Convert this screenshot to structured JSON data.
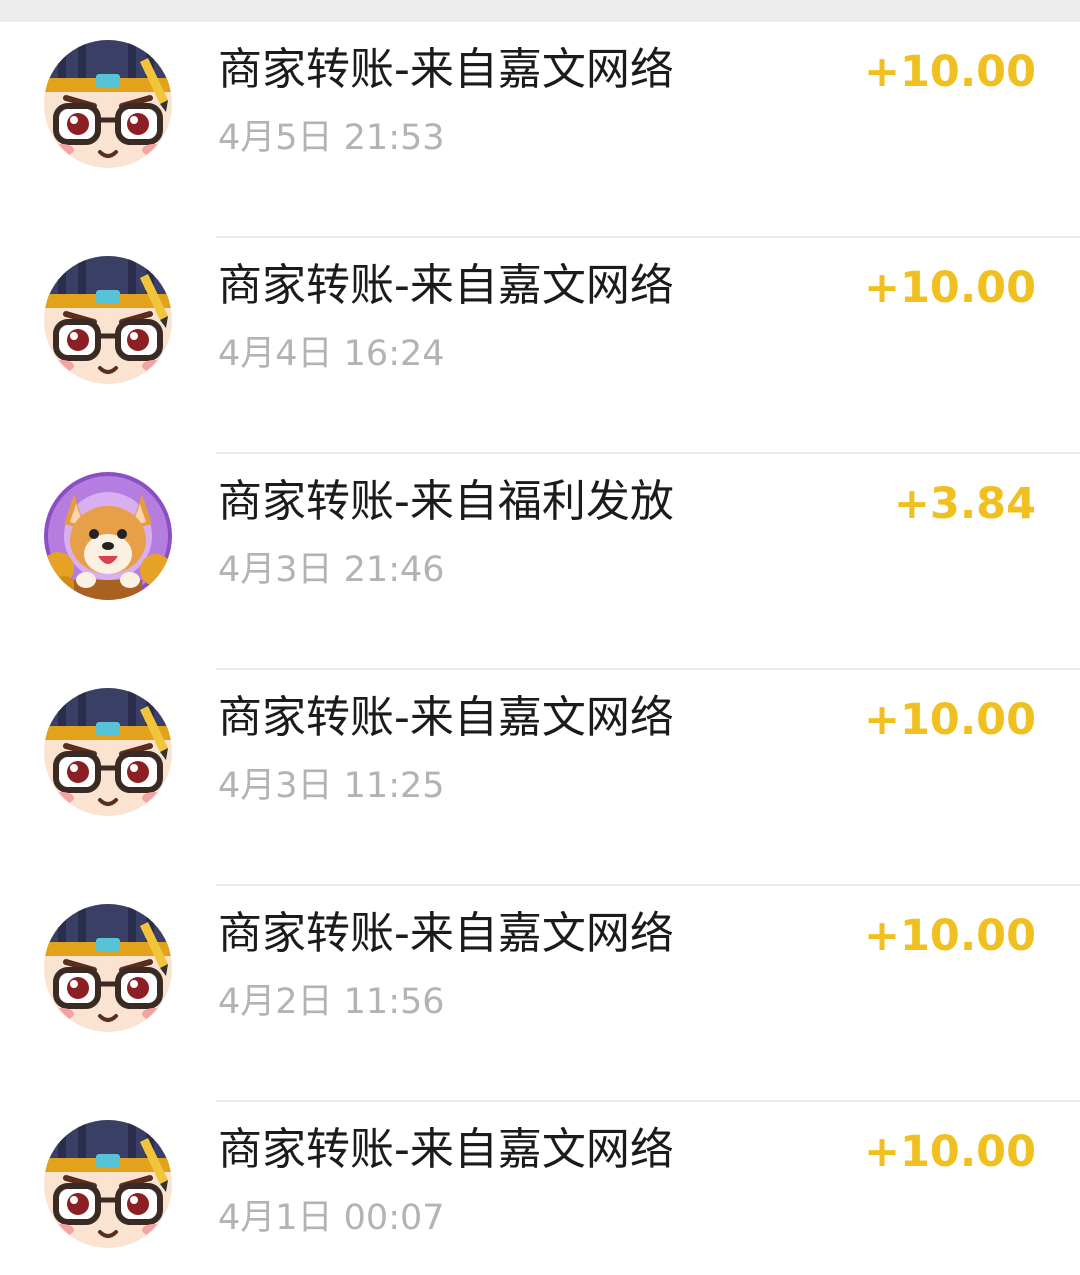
{
  "colors": {
    "amount": "#f0c020",
    "title": "#1b1b1b",
    "time": "#b3b3b3",
    "divider": "#e9e9e9"
  },
  "transactions": [
    {
      "title": "商家转账-来自嘉文网络",
      "time": "4月5日 21:53",
      "amount": "+10.00",
      "avatar": "cartoon-boy-glasses-avatar"
    },
    {
      "title": "商家转账-来自嘉文网络",
      "time": "4月4日 16:24",
      "amount": "+10.00",
      "avatar": "cartoon-boy-glasses-avatar"
    },
    {
      "title": "商家转账-来自福利发放",
      "time": "4月3日 21:46",
      "amount": "+3.84",
      "avatar": "shiba-dog-coins-avatar"
    },
    {
      "title": "商家转账-来自嘉文网络",
      "time": "4月3日 11:25",
      "amount": "+10.00",
      "avatar": "cartoon-boy-glasses-avatar"
    },
    {
      "title": "商家转账-来自嘉文网络",
      "time": "4月2日 11:56",
      "amount": "+10.00",
      "avatar": "cartoon-boy-glasses-avatar"
    },
    {
      "title": "商家转账-来自嘉文网络",
      "time": "4月1日 00:07",
      "amount": "+10.00",
      "avatar": "cartoon-boy-glasses-avatar"
    }
  ]
}
